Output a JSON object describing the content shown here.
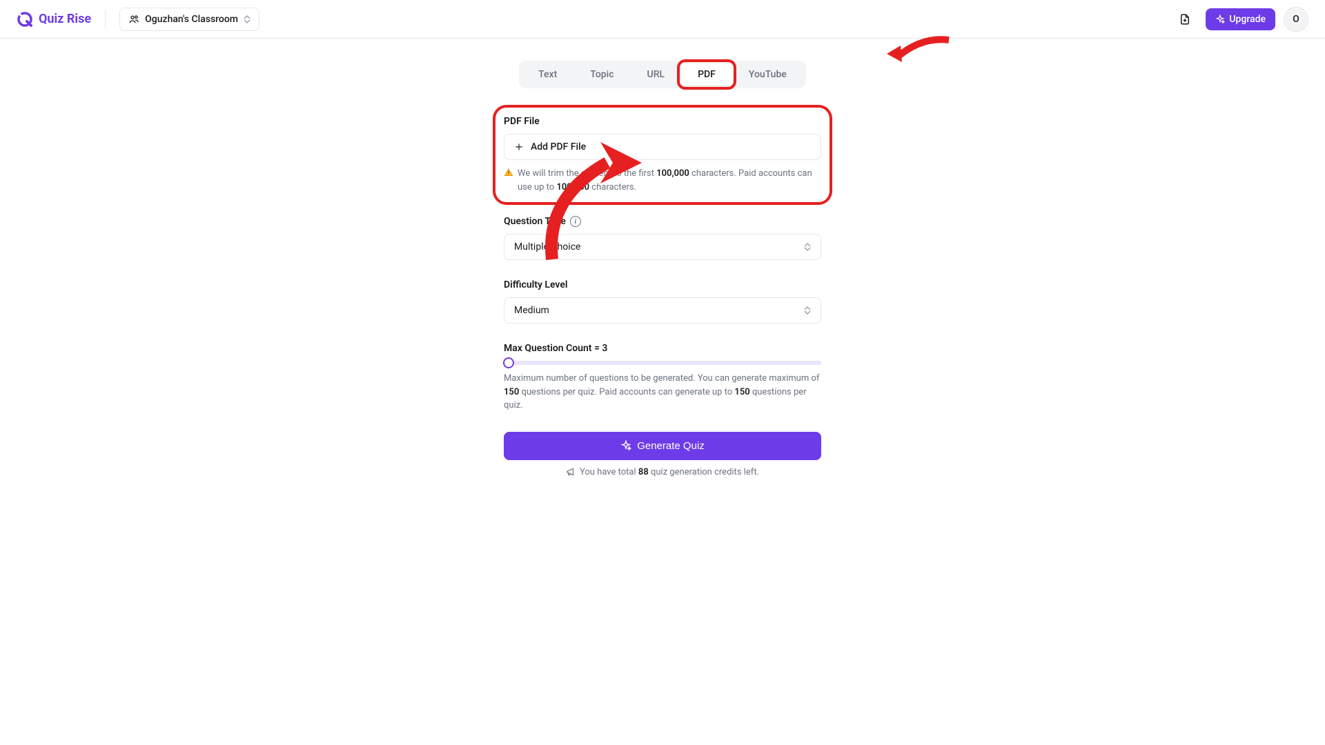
{
  "header": {
    "brand": "Quiz Rise",
    "classroom": "Oguzhan's Classroom",
    "upgrade": "Upgrade",
    "avatar_initial": "O"
  },
  "tabs": {
    "items": [
      "Text",
      "Topic",
      "URL",
      "PDF",
      "YouTube"
    ],
    "active": "PDF"
  },
  "pdf_section": {
    "label": "PDF File",
    "button": "Add PDF File",
    "helper_prefix": "We will trim the content to the first ",
    "helper_limit1": "100,000",
    "helper_mid": " characters. Paid accounts can use up to ",
    "helper_limit2": "100,000",
    "helper_suffix": " characters."
  },
  "question_type": {
    "label": "Question Type",
    "value": "Multiple Choice"
  },
  "difficulty": {
    "label": "Difficulty Level",
    "value": "Medium"
  },
  "max_count": {
    "label": "Max Question Count = 3",
    "helper_prefix": "Maximum number of questions to be generated. You can generate maximum of ",
    "helper_m1": "150",
    "helper_mid": " questions per quiz. Paid accounts can generate up to ",
    "helper_m2": "150",
    "helper_suffix": " questions per quiz."
  },
  "generate": {
    "label": "Generate Quiz",
    "credits_prefix": "You have total ",
    "credits_count": "88",
    "credits_suffix": " quiz generation credits left."
  }
}
